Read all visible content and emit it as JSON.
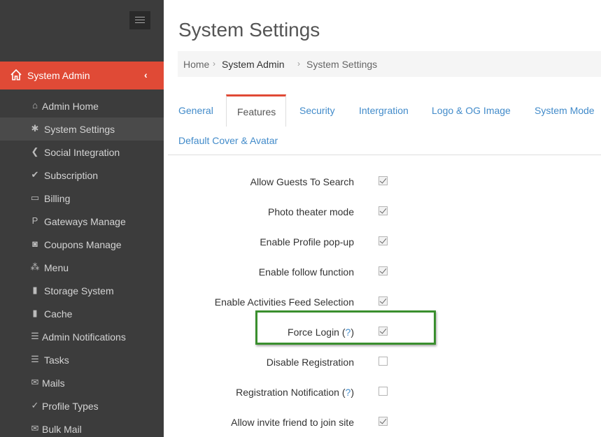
{
  "sidebar": {
    "section_title": "System Admin",
    "items": [
      {
        "label": "Admin Home",
        "icon": "home-icon",
        "glyph": "⌂"
      },
      {
        "label": "System Settings",
        "icon": "gear-icon",
        "glyph": "✱",
        "selected": true
      },
      {
        "label": "Social Integration",
        "icon": "share-icon",
        "glyph": "❮"
      },
      {
        "label": "Subscription",
        "icon": "check-icon",
        "glyph": "✔"
      },
      {
        "label": "Billing",
        "icon": "credit-card-icon",
        "glyph": "▭"
      },
      {
        "label": "Gateways Manage",
        "icon": "paypal-icon",
        "glyph": "P"
      },
      {
        "label": "Coupons Manage",
        "icon": "money-icon",
        "glyph": "◙"
      },
      {
        "label": "Menu",
        "icon": "sitemap-icon",
        "glyph": "⁂"
      },
      {
        "label": "Storage System",
        "icon": "file-icon",
        "glyph": "▮"
      },
      {
        "label": "Cache",
        "icon": "file-icon",
        "glyph": "▮"
      },
      {
        "label": "Admin Notifications",
        "icon": "list-icon",
        "glyph": "☰"
      },
      {
        "label": "Tasks",
        "icon": "list-icon",
        "glyph": "☰"
      },
      {
        "label": "Mails",
        "icon": "envelope-icon",
        "glyph": "✉"
      },
      {
        "label": "Profile Types",
        "icon": "check-circle-icon",
        "glyph": "✓"
      },
      {
        "label": "Bulk Mail",
        "icon": "envelope-icon",
        "glyph": "✉"
      }
    ]
  },
  "page": {
    "title": "System Settings",
    "breadcrumb": {
      "home": "Home",
      "section": "System Admin",
      "current": "System Settings"
    }
  },
  "tabs": [
    {
      "label": "General"
    },
    {
      "label": "Features",
      "active": true
    },
    {
      "label": "Security"
    },
    {
      "label": "Intergration"
    },
    {
      "label": "Logo & OG Image"
    },
    {
      "label": "System Mode"
    },
    {
      "label": "Default Cover & Avatar"
    }
  ],
  "settings": [
    {
      "label": "Allow Guests To Search",
      "checked": true
    },
    {
      "label": "Photo theater mode",
      "checked": true
    },
    {
      "label": "Enable Profile pop-up",
      "checked": true
    },
    {
      "label": "Enable follow function",
      "checked": true
    },
    {
      "label": "Enable Activities Feed Selection",
      "checked": true
    },
    {
      "label": "Force Login",
      "help": "?",
      "checked": true,
      "highlighted": true
    },
    {
      "label": "Disable Registration",
      "checked": false
    },
    {
      "label": "Registration Notification",
      "help": "?",
      "checked": false
    },
    {
      "label": "Allow invite friend to join site",
      "checked": true
    }
  ],
  "colors": {
    "accent": "#e04a36",
    "link": "#428bca",
    "sidebar_bg": "#3c3c3c",
    "highlight_border": "#3a8f2e"
  }
}
